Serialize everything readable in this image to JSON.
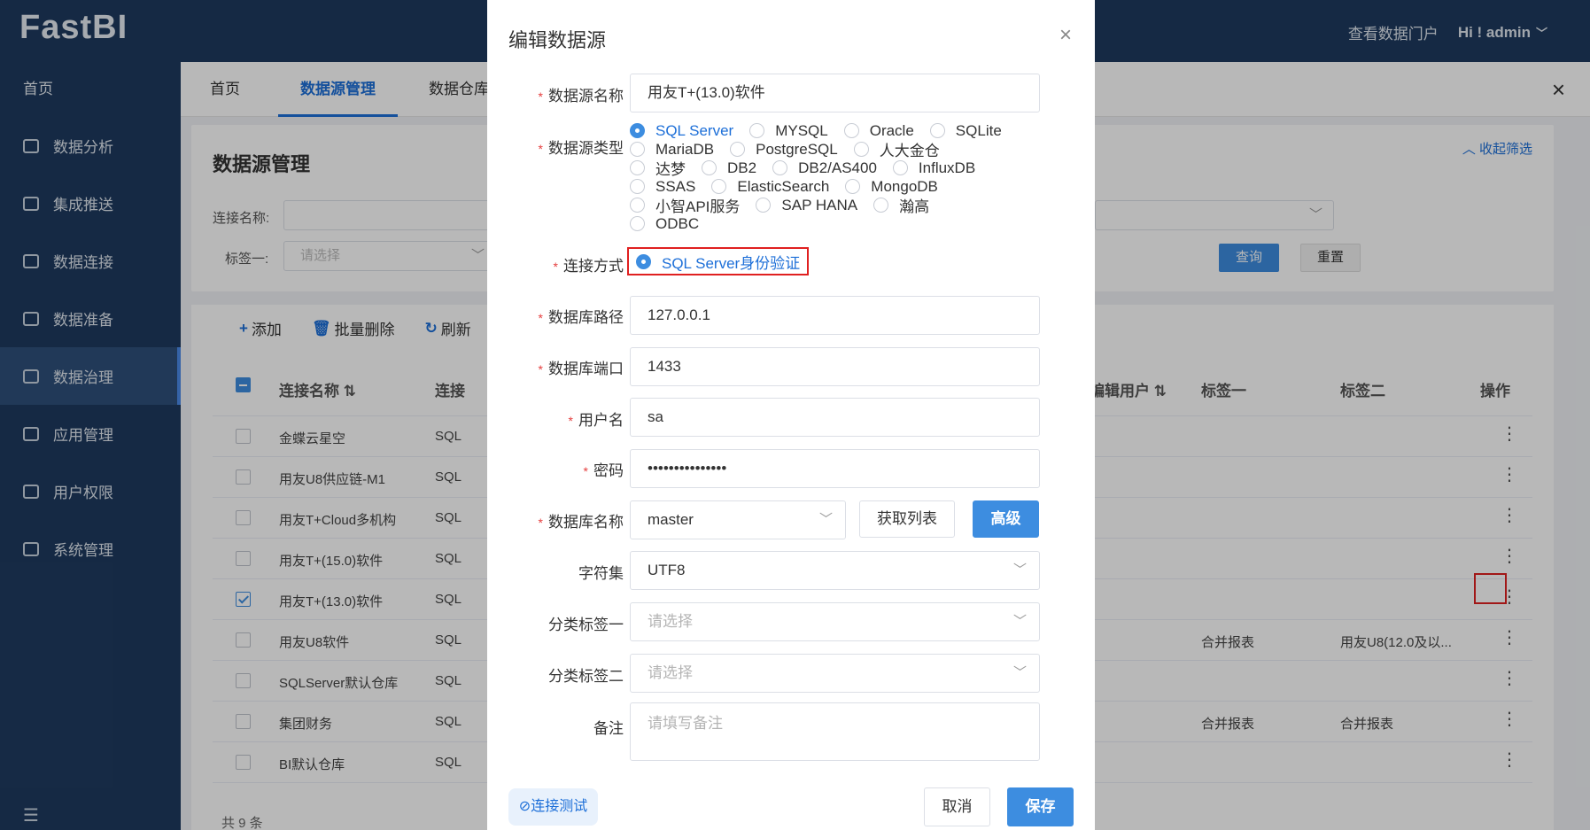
{
  "app": {
    "logo": "FastBI",
    "portal": "查看数据门户",
    "user": "Hi ! admin"
  },
  "sidebar": {
    "home": "首页",
    "items": [
      {
        "label": "数据分析",
        "icon": "chart-icon"
      },
      {
        "label": "集成推送",
        "icon": "push-icon"
      },
      {
        "label": "数据连接",
        "icon": "connect-icon"
      },
      {
        "label": "数据准备",
        "icon": "prepare-icon"
      },
      {
        "label": "数据治理",
        "icon": "layers-icon"
      },
      {
        "label": "应用管理",
        "icon": "grid-icon"
      },
      {
        "label": "用户权限",
        "icon": "user-permission-icon"
      },
      {
        "label": "系统管理",
        "icon": "system-icon"
      }
    ],
    "active_index": 4
  },
  "tabs": [
    "首页",
    "数据源管理",
    "数据仓库"
  ],
  "filter": {
    "title": "数据源管理",
    "collapse": "收起筛选",
    "conn_name_label": "连接名称:",
    "tag1_label": "标签一:",
    "tag1_placeholder": "请选择",
    "query": "查询",
    "reset": "重置"
  },
  "toolbar": {
    "add": "添加",
    "batch_delete": "批量删除",
    "refresh": "刷新"
  },
  "table": {
    "headers": {
      "name": "连接名称",
      "type": "连接",
      "edit_user": "编辑用户",
      "tag1": "标签一",
      "tag2": "标签二",
      "ops": "操作"
    },
    "rows": [
      {
        "name": "金蝶云星空",
        "type": "SQL",
        "tag1": "",
        "tag2": "",
        "checked": false
      },
      {
        "name": "用友U8供应链-M1",
        "type": "SQL",
        "tag1": "",
        "tag2": "",
        "checked": false
      },
      {
        "name": "用友T+Cloud多机构",
        "type": "SQL",
        "tag1": "",
        "tag2": "",
        "checked": false
      },
      {
        "name": "用友T+(15.0)软件",
        "type": "SQL",
        "tag1": "",
        "tag2": "",
        "checked": false
      },
      {
        "name": "用友T+(13.0)软件",
        "type": "SQL",
        "tag1": "",
        "tag2": "",
        "checked": true
      },
      {
        "name": "用友U8软件",
        "type": "SQL",
        "tag1": "合并报表",
        "tag2": "用友U8(12.0及以...",
        "checked": false
      },
      {
        "name": "SQLServer默认仓库",
        "type": "SQL",
        "tag1": "",
        "tag2": "",
        "checked": false
      },
      {
        "name": "集团财务",
        "type": "SQL",
        "tag1": "合并报表",
        "tag2": "合并报表",
        "checked": false
      },
      {
        "name": "BI默认仓库",
        "type": "SQL",
        "tag1": "",
        "tag2": "",
        "checked": false
      }
    ],
    "footer": "共 9 条"
  },
  "dialog": {
    "title": "编辑数据源",
    "labels": {
      "ds_name": "数据源名称",
      "ds_type": "数据源类型",
      "conn_mode": "连接方式",
      "db_path": "数据库路径",
      "db_port": "数据库端口",
      "username": "用户名",
      "password": "密码",
      "db_name": "数据库名称",
      "charset": "字符集",
      "cat_tag1": "分类标签一",
      "cat_tag2": "分类标签二",
      "remark": "备注"
    },
    "values": {
      "ds_name": "用友T+(13.0)软件",
      "db_path": "127.0.0.1",
      "db_port": "1433",
      "username": "sa",
      "password": "•••••••••••••••",
      "db_name": "master",
      "charset": "UTF8",
      "select_placeholder": "请选择",
      "remark_placeholder": "请填写备注"
    },
    "ds_types": [
      [
        "SQL Server",
        "MYSQL",
        "Oracle",
        "SQLite"
      ],
      [
        "MariaDB",
        "PostgreSQL",
        "人大金仓"
      ],
      [
        "达梦",
        "DB2",
        "DB2/AS400",
        "InfluxDB"
      ],
      [
        "SSAS",
        "ElasticSearch",
        "MongoDB"
      ],
      [
        "小智API服务",
        "SAP HANA",
        "瀚高"
      ],
      [
        "ODBC"
      ]
    ],
    "selected_type": "SQL Server",
    "conn_mode_option": "SQL Server身份验证",
    "buttons": {
      "fetch_list": "获取列表",
      "advanced": "高级",
      "test": "连接测试",
      "cancel": "取消",
      "save": "保存"
    }
  }
}
